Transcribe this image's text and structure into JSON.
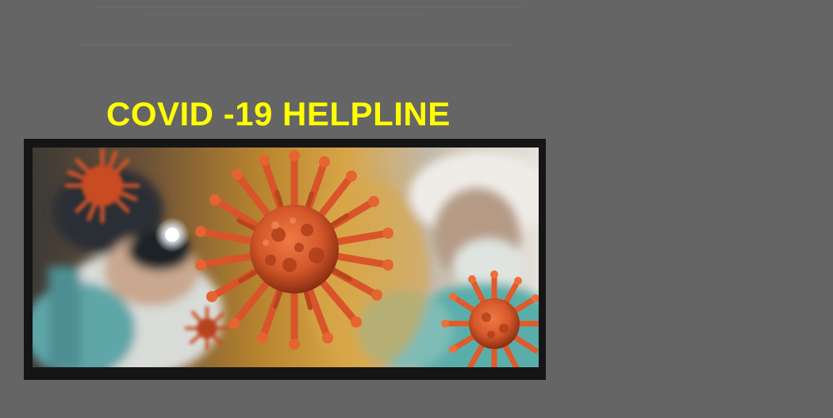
{
  "banner": {
    "title": "COVID -19 HELPLINE",
    "title_color": "#ffff00",
    "background_color": "#656565"
  },
  "image": {
    "subject": "coronavirus-medical-workers-photo",
    "virus_color": "#d9542a"
  }
}
